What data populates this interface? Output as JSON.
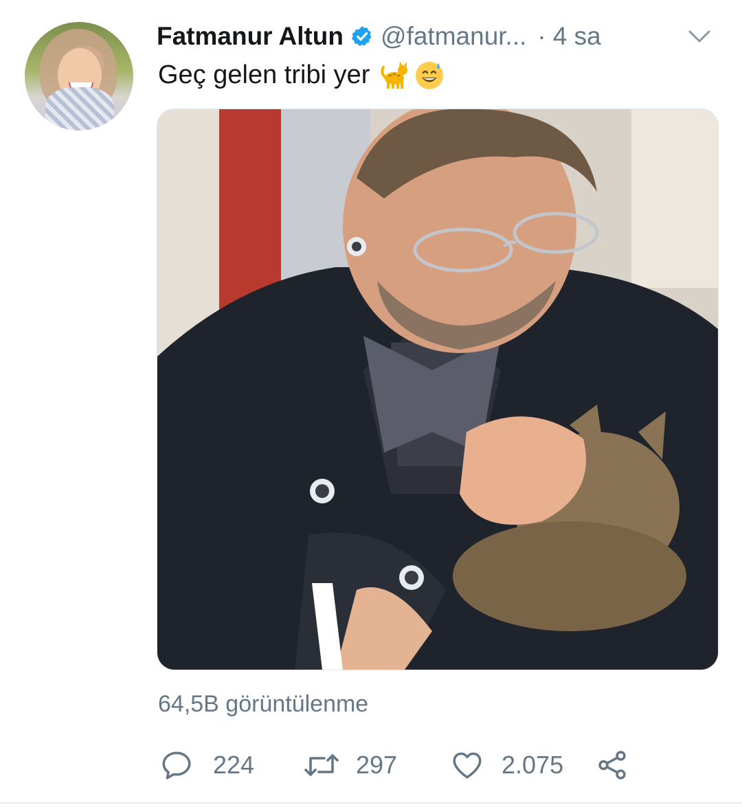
{
  "tweet": {
    "author": {
      "display_name": "Fatmanur Altun",
      "handle": "@fatmanur...",
      "verified": true
    },
    "separator": "·",
    "time": "4 sa",
    "text": "Geç gelen tribi yer",
    "emojis": [
      "cat-emoji",
      "grinning-sweat-emoji"
    ],
    "media": {
      "type": "video-thumbnail"
    },
    "views": "64,5B görüntülenme",
    "actions": {
      "replies": "224",
      "retweets": "297",
      "likes": "2.075"
    }
  },
  "colors": {
    "text_primary": "#14171a",
    "text_secondary": "#657786",
    "verified_blue": "#1da1f2",
    "divider": "#e6ecf0"
  },
  "icons": {
    "verified": "verified-badge-icon",
    "caret": "chevron-down-icon",
    "reply": "reply-icon",
    "retweet": "retweet-icon",
    "like": "heart-icon",
    "share": "share-icon"
  }
}
